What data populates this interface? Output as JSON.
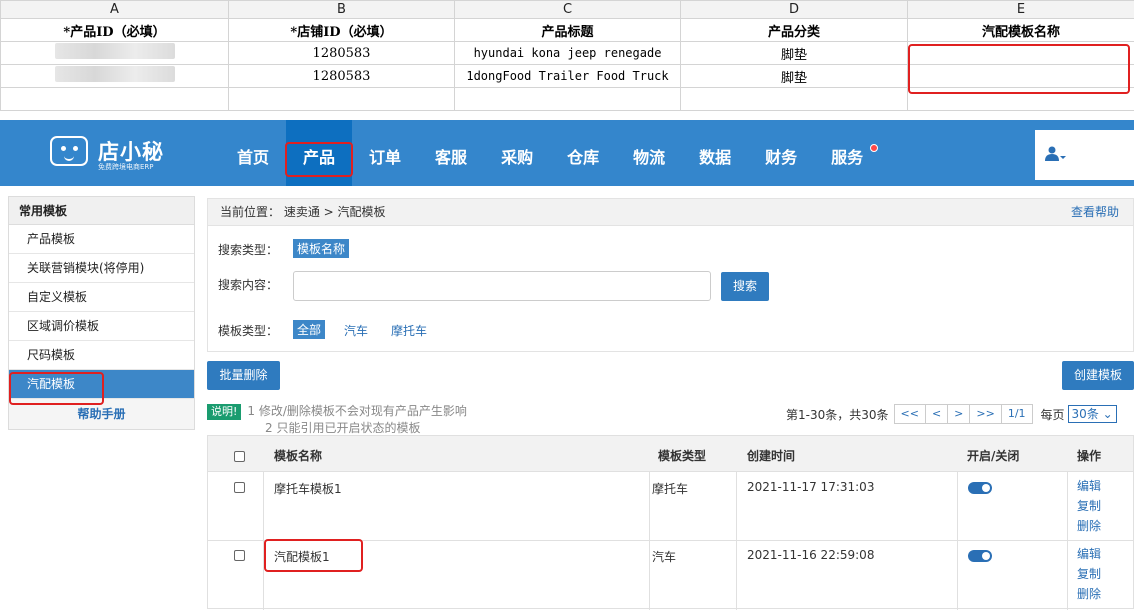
{
  "sheet": {
    "columns": [
      "A",
      "B",
      "C",
      "D",
      "E"
    ],
    "headers": [
      "*产品ID（必填）",
      "*店铺ID（必填）",
      "产品标题",
      "产品分类",
      "汽配模板名称"
    ],
    "rows": [
      {
        "store_id": "1280583",
        "title": "hyundai kona  jeep renegade",
        "category": "脚垫",
        "template": ""
      },
      {
        "store_id": "1280583",
        "title": "1dongFood Trailer Food Truck",
        "category": "脚垫",
        "template": ""
      }
    ]
  },
  "app": {
    "logo_title": "店小秘",
    "logo_subtitle": "免费跨境电商ERP",
    "nav": [
      "首页",
      "产品",
      "订单",
      "客服",
      "采购",
      "仓库",
      "物流",
      "数据",
      "财务",
      "服务"
    ],
    "active_nav": "产品",
    "colors": {
      "topbar": "#3486cc",
      "accent": "#2f7bbf",
      "highlight": "#e02020",
      "notice_tag": "#1a9c6f"
    }
  },
  "sidebar": {
    "heading": "常用模板",
    "items": [
      "产品模板",
      "关联营销模块(将停用)",
      "自定义模板",
      "区域调价模板",
      "尺码模板",
      "汽配模板"
    ],
    "active": "汽配模板",
    "help": "帮助手册"
  },
  "breadcrumb": {
    "label": "当前位置：",
    "path": "速卖通 > 汽配模板",
    "help_link": "查看帮助"
  },
  "search": {
    "type_label": "搜索类型：",
    "type_value": "模板名称",
    "content_label": "搜索内容：",
    "content_value": "",
    "search_button": "搜索",
    "template_type_label": "模板类型：",
    "template_types": [
      "全部",
      "汽车",
      "摩托车"
    ]
  },
  "actions": {
    "batch_delete": "批量删除",
    "create": "创建模板"
  },
  "notice": {
    "tag": "说明!",
    "line1": "1 修改/删除模板不会对现有产品产生影响",
    "line2": "2 只能引用已开启状态的模板"
  },
  "pager": {
    "summary": "第1-30条，共30条",
    "first": "<<",
    "prev": "<",
    "next": ">",
    "last": ">>",
    "page": "1/1",
    "per_page_label": "每页",
    "per_page_value": "30条"
  },
  "table": {
    "headers": {
      "name": "模板名称",
      "type": "模板类型",
      "created": "创建时间",
      "toggle": "开启/关闭",
      "ops": "操作"
    },
    "rows": [
      {
        "name": "摩托车模板1",
        "type": "摩托车",
        "created": "2021-11-17 17:31:03",
        "enabled": true,
        "ops": [
          "编辑",
          "复制",
          "删除"
        ]
      },
      {
        "name": "汽配模板1",
        "type": "汽车",
        "created": "2021-11-16 22:59:08",
        "enabled": true,
        "ops": [
          "编辑",
          "复制",
          "删除"
        ]
      }
    ]
  }
}
